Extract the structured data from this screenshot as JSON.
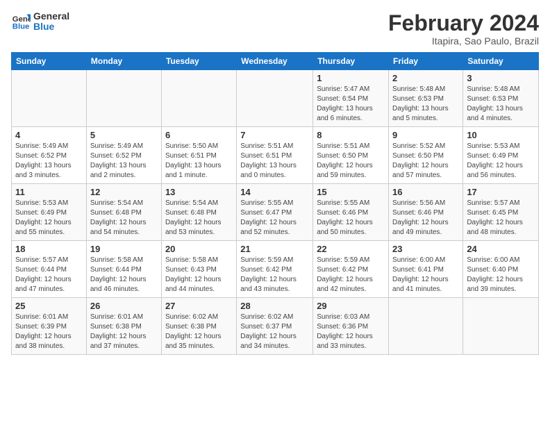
{
  "header": {
    "logo_line1": "General",
    "logo_line2": "Blue",
    "title": "February 2024",
    "subtitle": "Itapira, Sao Paulo, Brazil"
  },
  "days_of_week": [
    "Sunday",
    "Monday",
    "Tuesday",
    "Wednesday",
    "Thursday",
    "Friday",
    "Saturday"
  ],
  "weeks": [
    {
      "days": [
        {
          "num": "",
          "info": ""
        },
        {
          "num": "",
          "info": ""
        },
        {
          "num": "",
          "info": ""
        },
        {
          "num": "",
          "info": ""
        },
        {
          "num": "1",
          "info": "Sunrise: 5:47 AM\nSunset: 6:54 PM\nDaylight: 13 hours\nand 6 minutes."
        },
        {
          "num": "2",
          "info": "Sunrise: 5:48 AM\nSunset: 6:53 PM\nDaylight: 13 hours\nand 5 minutes."
        },
        {
          "num": "3",
          "info": "Sunrise: 5:48 AM\nSunset: 6:53 PM\nDaylight: 13 hours\nand 4 minutes."
        }
      ]
    },
    {
      "days": [
        {
          "num": "4",
          "info": "Sunrise: 5:49 AM\nSunset: 6:52 PM\nDaylight: 13 hours\nand 3 minutes."
        },
        {
          "num": "5",
          "info": "Sunrise: 5:49 AM\nSunset: 6:52 PM\nDaylight: 13 hours\nand 2 minutes."
        },
        {
          "num": "6",
          "info": "Sunrise: 5:50 AM\nSunset: 6:51 PM\nDaylight: 13 hours\nand 1 minute."
        },
        {
          "num": "7",
          "info": "Sunrise: 5:51 AM\nSunset: 6:51 PM\nDaylight: 13 hours\nand 0 minutes."
        },
        {
          "num": "8",
          "info": "Sunrise: 5:51 AM\nSunset: 6:50 PM\nDaylight: 12 hours\nand 59 minutes."
        },
        {
          "num": "9",
          "info": "Sunrise: 5:52 AM\nSunset: 6:50 PM\nDaylight: 12 hours\nand 57 minutes."
        },
        {
          "num": "10",
          "info": "Sunrise: 5:53 AM\nSunset: 6:49 PM\nDaylight: 12 hours\nand 56 minutes."
        }
      ]
    },
    {
      "days": [
        {
          "num": "11",
          "info": "Sunrise: 5:53 AM\nSunset: 6:49 PM\nDaylight: 12 hours\nand 55 minutes."
        },
        {
          "num": "12",
          "info": "Sunrise: 5:54 AM\nSunset: 6:48 PM\nDaylight: 12 hours\nand 54 minutes."
        },
        {
          "num": "13",
          "info": "Sunrise: 5:54 AM\nSunset: 6:48 PM\nDaylight: 12 hours\nand 53 minutes."
        },
        {
          "num": "14",
          "info": "Sunrise: 5:55 AM\nSunset: 6:47 PM\nDaylight: 12 hours\nand 52 minutes."
        },
        {
          "num": "15",
          "info": "Sunrise: 5:55 AM\nSunset: 6:46 PM\nDaylight: 12 hours\nand 50 minutes."
        },
        {
          "num": "16",
          "info": "Sunrise: 5:56 AM\nSunset: 6:46 PM\nDaylight: 12 hours\nand 49 minutes."
        },
        {
          "num": "17",
          "info": "Sunrise: 5:57 AM\nSunset: 6:45 PM\nDaylight: 12 hours\nand 48 minutes."
        }
      ]
    },
    {
      "days": [
        {
          "num": "18",
          "info": "Sunrise: 5:57 AM\nSunset: 6:44 PM\nDaylight: 12 hours\nand 47 minutes."
        },
        {
          "num": "19",
          "info": "Sunrise: 5:58 AM\nSunset: 6:44 PM\nDaylight: 12 hours\nand 46 minutes."
        },
        {
          "num": "20",
          "info": "Sunrise: 5:58 AM\nSunset: 6:43 PM\nDaylight: 12 hours\nand 44 minutes."
        },
        {
          "num": "21",
          "info": "Sunrise: 5:59 AM\nSunset: 6:42 PM\nDaylight: 12 hours\nand 43 minutes."
        },
        {
          "num": "22",
          "info": "Sunrise: 5:59 AM\nSunset: 6:42 PM\nDaylight: 12 hours\nand 42 minutes."
        },
        {
          "num": "23",
          "info": "Sunrise: 6:00 AM\nSunset: 6:41 PM\nDaylight: 12 hours\nand 41 minutes."
        },
        {
          "num": "24",
          "info": "Sunrise: 6:00 AM\nSunset: 6:40 PM\nDaylight: 12 hours\nand 39 minutes."
        }
      ]
    },
    {
      "days": [
        {
          "num": "25",
          "info": "Sunrise: 6:01 AM\nSunset: 6:39 PM\nDaylight: 12 hours\nand 38 minutes."
        },
        {
          "num": "26",
          "info": "Sunrise: 6:01 AM\nSunset: 6:38 PM\nDaylight: 12 hours\nand 37 minutes."
        },
        {
          "num": "27",
          "info": "Sunrise: 6:02 AM\nSunset: 6:38 PM\nDaylight: 12 hours\nand 35 minutes."
        },
        {
          "num": "28",
          "info": "Sunrise: 6:02 AM\nSunset: 6:37 PM\nDaylight: 12 hours\nand 34 minutes."
        },
        {
          "num": "29",
          "info": "Sunrise: 6:03 AM\nSunset: 6:36 PM\nDaylight: 12 hours\nand 33 minutes."
        },
        {
          "num": "",
          "info": ""
        },
        {
          "num": "",
          "info": ""
        }
      ]
    }
  ]
}
